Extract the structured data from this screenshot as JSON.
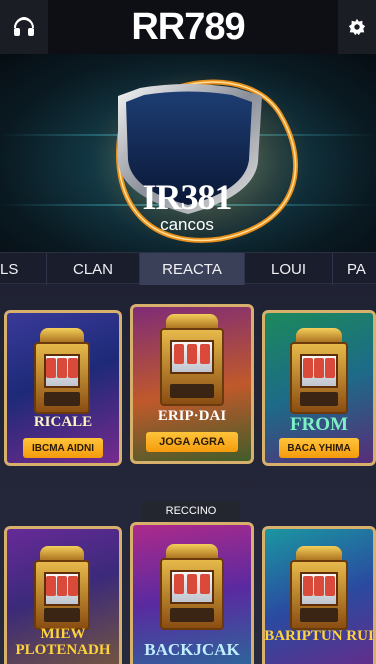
{
  "header": {
    "title": "RR789",
    "left_icon": "fork-knife-icon",
    "right_icon": "gear-icon"
  },
  "hero": {
    "emblem_line1": "IR381",
    "emblem_line2": "cancos"
  },
  "tabs": [
    {
      "label": "LS",
      "active": false
    },
    {
      "label": "CLAN",
      "active": false
    },
    {
      "label": "REACTA",
      "active": true
    },
    {
      "label": "LOUI",
      "active": false
    },
    {
      "label": "PA",
      "active": false
    }
  ],
  "games_row1": [
    {
      "title": "RICALE",
      "button": "IBCMA AIDNI"
    },
    {
      "title": "ERIP·DAI",
      "button": "JOGA AGRA"
    },
    {
      "title": "FROM",
      "button": "BACA YHIMA"
    }
  ],
  "section_label": "RECCINO",
  "games_row2": [
    {
      "title": "MIEW PLOTENADH"
    },
    {
      "title": "BACKJCAK"
    },
    {
      "title": "BARIPTUN RUI"
    }
  ],
  "colors": {
    "accent": "#f59a0c",
    "frame_gold": "#d7b06b",
    "tab_active": "#3a4058",
    "header_bg": "#0e0f14"
  }
}
